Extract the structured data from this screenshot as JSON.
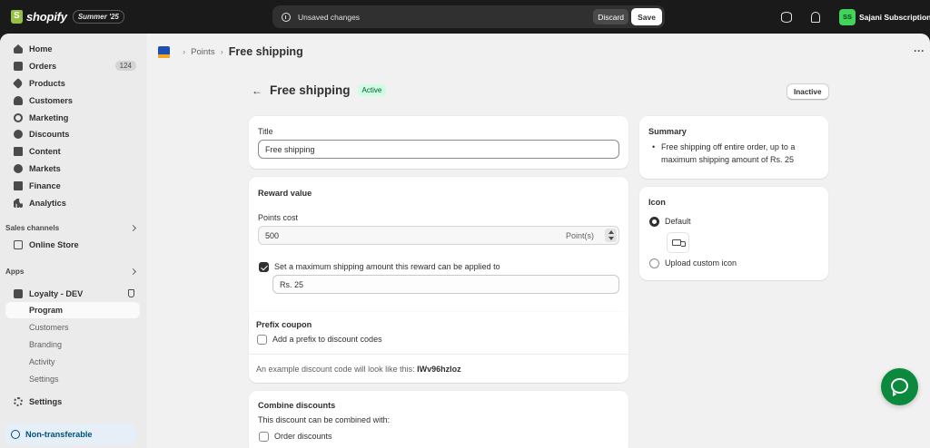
{
  "topbar": {
    "brand": "shopify",
    "edition_badge": "Summer '25",
    "unsaved_message": "Unsaved changes",
    "discard_label": "Discard",
    "save_label": "Save",
    "avatar_initials": "SS",
    "store_name": "Sajani Subscription"
  },
  "sidebar": {
    "items": [
      {
        "label": "Home",
        "icon": "home-icon"
      },
      {
        "label": "Orders",
        "icon": "orders-icon",
        "count": "124"
      },
      {
        "label": "Products",
        "icon": "tag-icon"
      },
      {
        "label": "Customers",
        "icon": "person-icon"
      },
      {
        "label": "Marketing",
        "icon": "target-icon"
      },
      {
        "label": "Discounts",
        "icon": "discount-icon"
      },
      {
        "label": "Content",
        "icon": "content-icon"
      },
      {
        "label": "Markets",
        "icon": "globe-icon"
      },
      {
        "label": "Finance",
        "icon": "bank-icon"
      },
      {
        "label": "Analytics",
        "icon": "bar-chart-icon"
      }
    ],
    "sales_channels_label": "Sales channels",
    "online_store_label": "Online Store",
    "apps_label": "Apps",
    "app_name": "Loyalty - DEV",
    "app_subitems": [
      "Program",
      "Customers",
      "Branding",
      "Activity",
      "Settings"
    ],
    "settings_label": "Settings",
    "non_transferable_label": "Non-transferable"
  },
  "breadcrumb": {
    "parent": "Points",
    "current": "Free shipping"
  },
  "page": {
    "title": "Free shipping",
    "status": "Active",
    "inactive_button": "Inactive"
  },
  "title_card": {
    "label": "Title",
    "value": "Free shipping"
  },
  "reward_card": {
    "heading": "Reward value",
    "points_label": "Points cost",
    "points_value": "500",
    "points_suffix": "Point(s)",
    "max_checkbox_label": "Set a maximum shipping amount this reward can be applied to",
    "max_checked": true,
    "max_amount": "Rs. 25"
  },
  "prefix_card": {
    "heading": "Prefix coupon",
    "checkbox_label": "Add a prefix to discount codes",
    "example_prefix": "An example discount code will look like this:",
    "example_code": "IWv96hzloz"
  },
  "combine_card": {
    "heading": "Combine discounts",
    "subtext": "This discount can be combined with:",
    "option_orders": "Order discounts"
  },
  "summary_card": {
    "heading": "Summary",
    "bullet_line1": "Free shipping off entire order, up to a",
    "bullet_line2": "maximum shipping amount of Rs. 25"
  },
  "icon_card": {
    "heading": "Icon",
    "option_default": "Default",
    "option_custom": "Upload custom icon",
    "selected": "Default"
  },
  "colors": {
    "topbar": "#1a1a1a",
    "background": "#f1f1f1",
    "sidebar": "#ebebeb",
    "active_badge": "#cdfee1",
    "chat_button": "#0b8a3e",
    "avatar": "#42d35b"
  }
}
